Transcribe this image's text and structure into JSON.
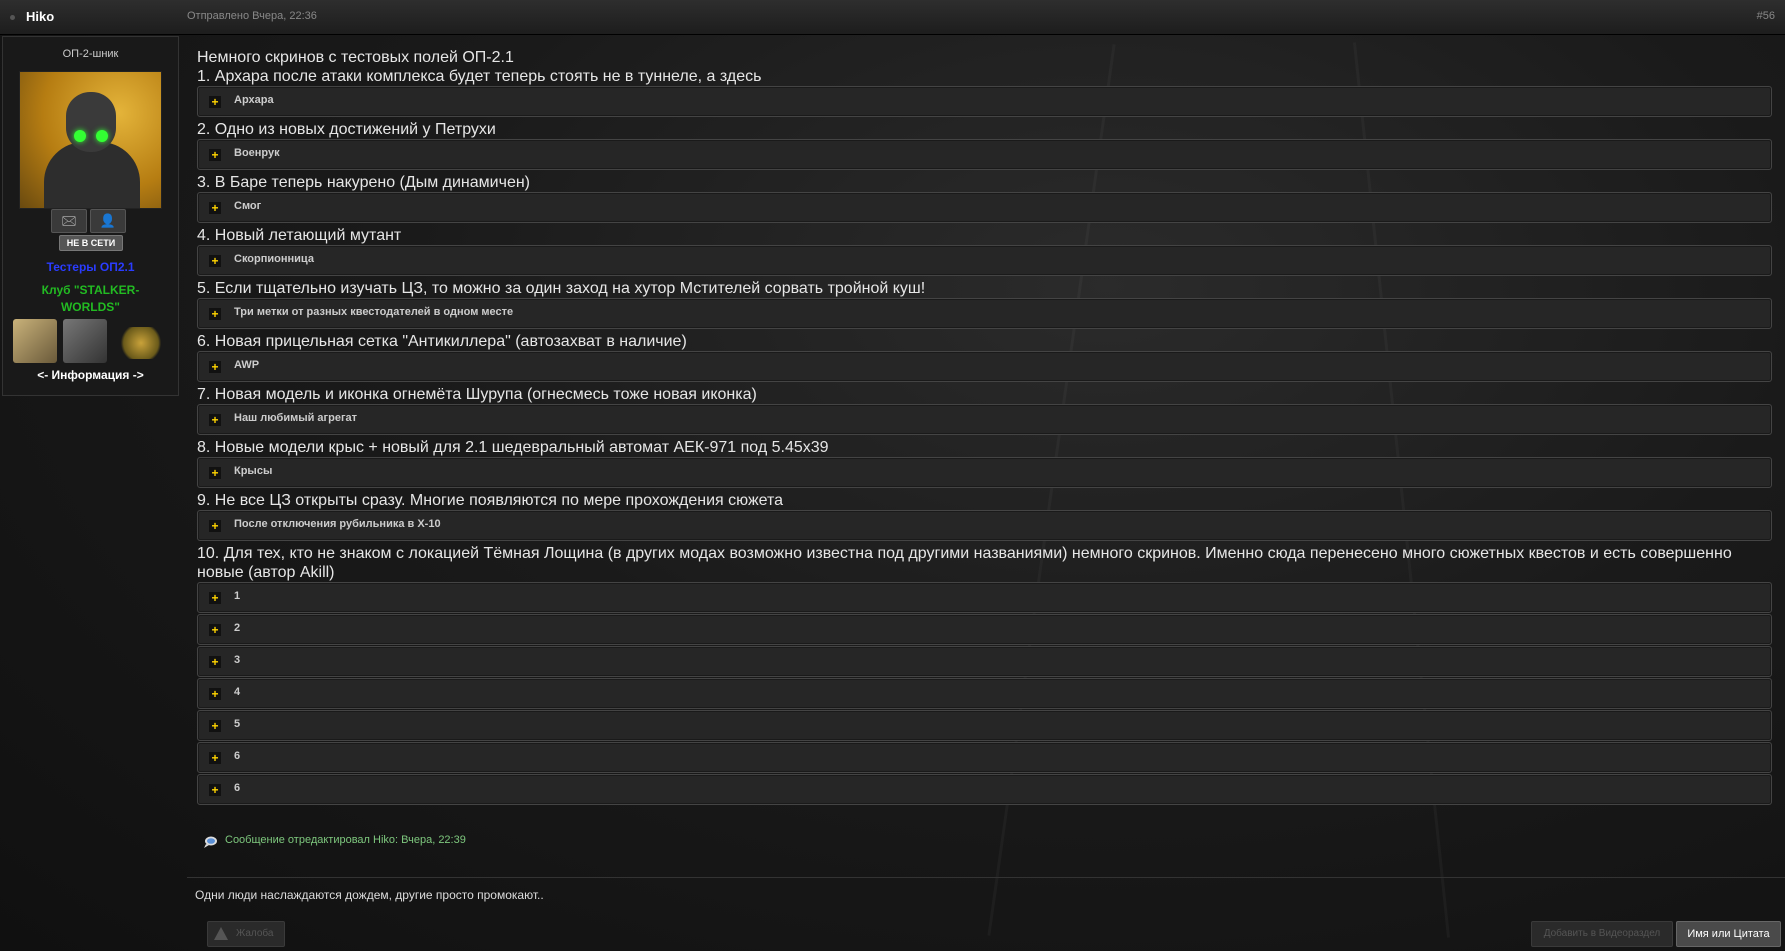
{
  "header": {
    "author": "Hiko",
    "posted": "Отправлено Вчера, 22:36",
    "post_number": "#56"
  },
  "user": {
    "rank": "ОП-2-шник",
    "status": "НЕ В СЕТИ",
    "group": "Тестеры ОП2.1",
    "club": "Клуб \"STALKER-WORLDS\"",
    "info_link": "<- Информация ->",
    "buttons": [
      "message-icon",
      "add-friend-icon"
    ]
  },
  "post": {
    "intro": "Немного скринов с тестовых полей ОП-2.1",
    "sections": [
      {
        "text": "1. Архара после атаки комплекса будет теперь стоять не в туннеле, а здесь",
        "spoilers": [
          "Архара"
        ]
      },
      {
        "text": "2. Одно из новых достижений у Петрухи",
        "spoilers": [
          "Военрук"
        ]
      },
      {
        "text": "3. В Баре теперь накурено (Дым динамичен)",
        "spoilers": [
          "Смог"
        ]
      },
      {
        "text": "4. Новый летающий мутант",
        "spoilers": [
          "Скорпионница"
        ]
      },
      {
        "text": "5. Если тщательно изучать ЦЗ, то можно за один заход на хутор Мстителей сорвать тройной куш!",
        "spoilers": [
          "Три метки от разных квестодателей в одном месте"
        ]
      },
      {
        "text": "6. Новая прицельная сетка \"Антикиллера\" (автозахват в наличие)",
        "spoilers": [
          "AWP"
        ]
      },
      {
        "text": "7. Новая модель и иконка огнемёта Шурупа (огнесмесь тоже новая иконка)",
        "spoilers": [
          "Наш любимый агрегат"
        ]
      },
      {
        "text": "8. Новые модели крыс + новый для 2.1 шедевральный автомат АЕК-971 под 5.45x39",
        "spoilers": [
          "Крысы"
        ]
      },
      {
        "text": "9. Не все ЦЗ открыты сразу. Многие появляются по мере прохождения сюжета",
        "spoilers": [
          "После отключения рубильника в Х-10"
        ]
      },
      {
        "text": "10. Для тех, кто не знаком с локацией Тёмная Лощина (в других модах возможно известна под другими названиями) немного скринов. Именно сюда перенесено много сюжетных квестов и есть совершенно новые (автор Akill)",
        "spoilers": [
          "1",
          "2",
          "3",
          "4",
          "5",
          "6",
          "6"
        ]
      }
    ],
    "edited": "Сообщение отредактировал Hiko: Вчера, 22:39",
    "signature": "Одни люди наслаждаются дождем, другие просто промокают.."
  },
  "actions": {
    "complain": "Жалоба",
    "add_video": "Добавить в Видеораздел",
    "quote": "Имя или Цитата"
  },
  "colors": {
    "group": "#2a3cff",
    "club": "#22bb22",
    "spoiler_plus": "#ffd400",
    "edited": "#7ec87e"
  }
}
